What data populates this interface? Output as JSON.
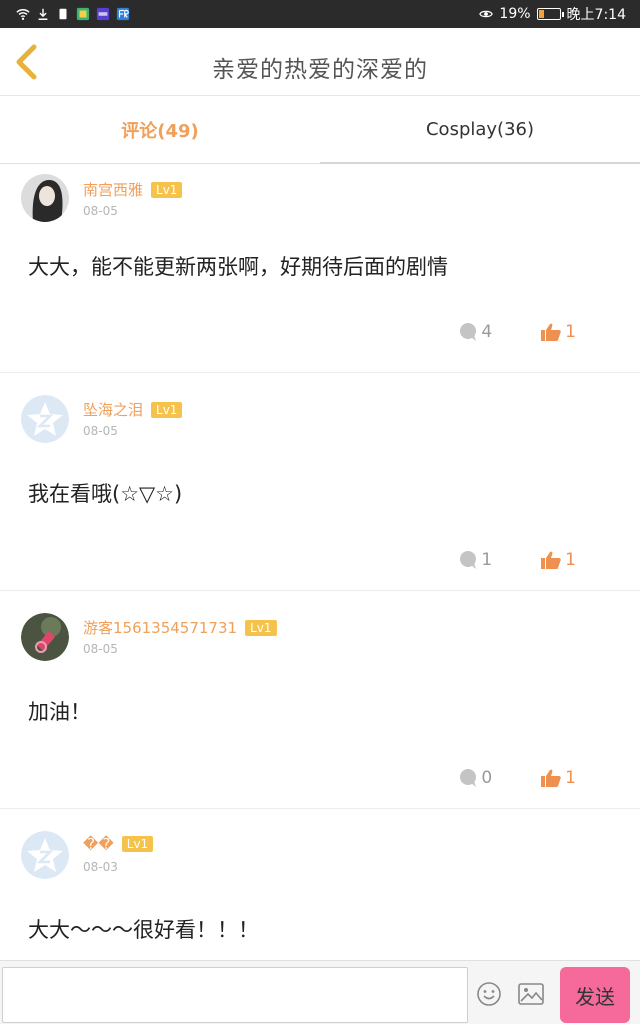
{
  "status_bar": {
    "battery": "19%",
    "time": "晚上7:14",
    "icons": [
      "wifi-icon",
      "download-icon",
      "sim-icon",
      "notification-icon",
      "app-icon",
      "app-fr-icon",
      "eye-icon",
      "battery-icon"
    ]
  },
  "header": {
    "title": "亲爱的热爱的深爱的",
    "back_icon": "chevron-left-icon"
  },
  "tabs": [
    {
      "label": "评论(49)",
      "active": true
    },
    {
      "label": "Cosplay(36)",
      "active": false
    }
  ],
  "comments": [
    {
      "user": "南宫西雅",
      "level": "Lv1",
      "date": "08-05",
      "text": "大大，能不能更新两张啊，好期待后面的剧情",
      "replies": "4",
      "likes": "1"
    },
    {
      "user": "坠海之泪",
      "level": "Lv1",
      "date": "08-05",
      "text": "我在看哦(☆▽☆)",
      "replies": "1",
      "likes": "1"
    },
    {
      "user": "游客1561354571731",
      "level": "Lv1",
      "date": "08-05",
      "text": "加油！",
      "replies": "0",
      "likes": "1"
    },
    {
      "user": "��",
      "level": "Lv1",
      "date": "08-03",
      "text": "大大～～～很好看！！！",
      "replies": "",
      "likes": ""
    }
  ],
  "input_bar": {
    "placeholder": "",
    "send_label": "发送"
  },
  "colors": {
    "accent": "#f0a05a",
    "like": "#f09050",
    "send_button": "#f56a9a",
    "level_badge": "#f5c24b"
  }
}
